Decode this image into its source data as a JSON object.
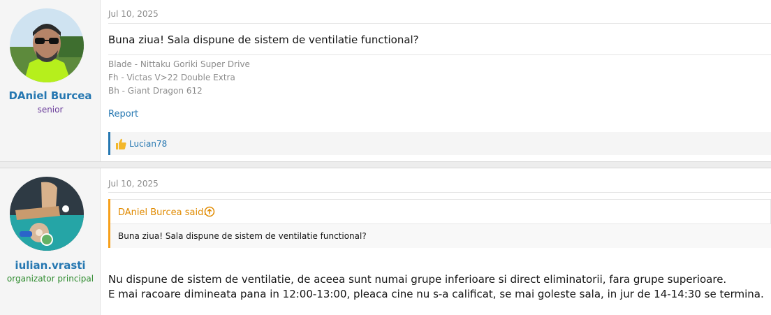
{
  "posts": [
    {
      "author": "DAniel Burcea",
      "author_title": "senior",
      "date": "Jul 10, 2025",
      "message": "Buna ziua! Sala dispune de sistem de ventilatie functional?",
      "signature": [
        "Blade - Nittaku Goriki Super Drive",
        "Fh - Victas V>22 Double Extra",
        "Bh - Giant Dragon 612"
      ],
      "report_label": "Report",
      "likes": "Lucian78"
    },
    {
      "author": "iulian.vrasti",
      "author_title": "organizator principal",
      "date": "Jul 10, 2025",
      "quote_author": "DAniel Burcea said:",
      "quote_text": "Buna ziua! Sala dispune de sistem de ventilatie functional?",
      "message_lines": [
        "Nu dispune de sistem de ventilatie, de aceea sunt numai grupe inferioare si direct eliminatorii, fara grupe superioare.",
        "E mai racoare dimineata pana in 12:00-13:00, pleaca cine nu s-a calificat, se mai goleste sala, in jur de 14-14:30 se termina."
      ]
    }
  ],
  "colors": {
    "link": "#2577b1",
    "quote_accent": "#f7a01b",
    "online": "#63b265",
    "title2": "#2e8b2e",
    "title1": "#6a3d9a"
  },
  "icons": {
    "like": "thumbs-up-icon",
    "quote_jump": "arrow-up-circle-icon",
    "online": "online-status-icon"
  }
}
